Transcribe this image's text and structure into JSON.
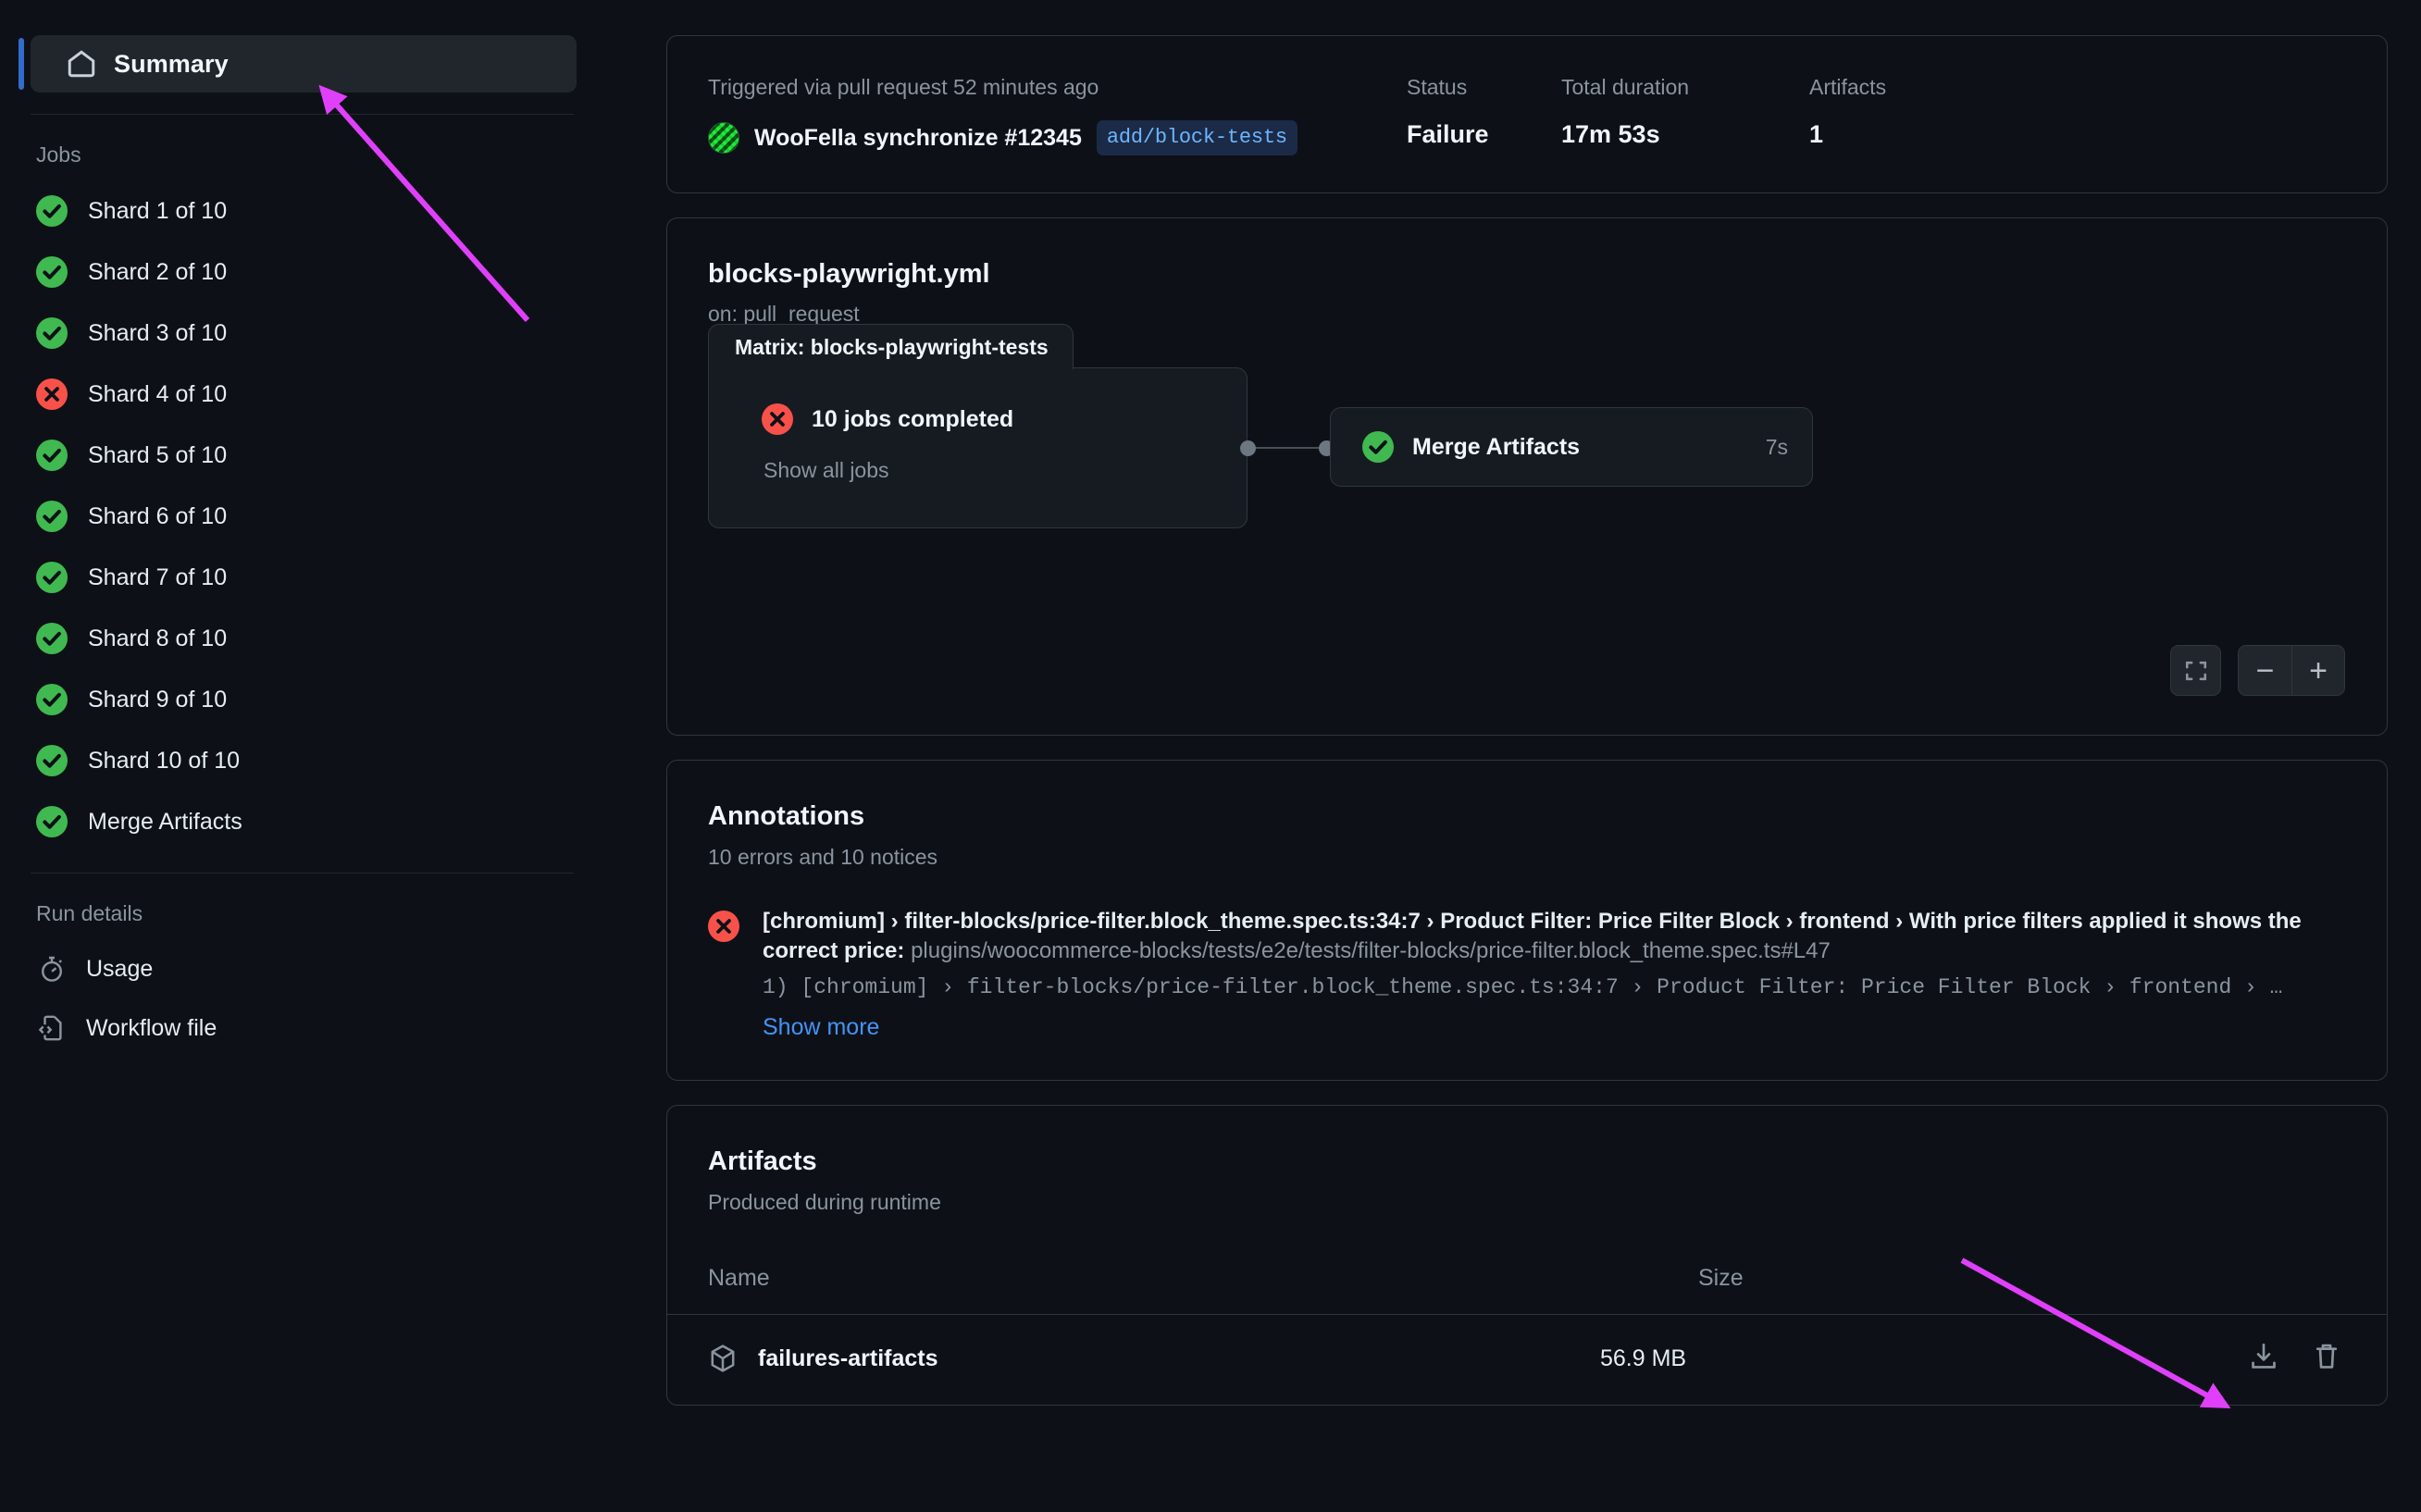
{
  "sidebar": {
    "summary": {
      "label": "Summary",
      "icon": "home-icon"
    },
    "jobs_title": "Jobs",
    "jobs": [
      {
        "label": "Shard 1 of 10",
        "status": "success"
      },
      {
        "label": "Shard 2 of 10",
        "status": "success"
      },
      {
        "label": "Shard 3 of 10",
        "status": "success"
      },
      {
        "label": "Shard 4 of 10",
        "status": "failure"
      },
      {
        "label": "Shard 5 of 10",
        "status": "success"
      },
      {
        "label": "Shard 6 of 10",
        "status": "success"
      },
      {
        "label": "Shard 7 of 10",
        "status": "success"
      },
      {
        "label": "Shard 8 of 10",
        "status": "success"
      },
      {
        "label": "Shard 9 of 10",
        "status": "success"
      },
      {
        "label": "Shard 10 of 10",
        "status": "success"
      },
      {
        "label": "Merge Artifacts",
        "status": "success"
      }
    ],
    "run_details_title": "Run details",
    "run_details": [
      {
        "label": "Usage",
        "icon": "stopwatch-icon"
      },
      {
        "label": "Workflow file",
        "icon": "code-file-icon"
      }
    ]
  },
  "header": {
    "trigger_text": "Triggered via pull request 52 minutes ago",
    "actor": "WooFella",
    "event": "synchronize",
    "pr_number": "#12345",
    "actor_line": "WooFella synchronize #12345",
    "branch": "add/block-tests",
    "status_label": "Status",
    "status_value": "Failure",
    "duration_label": "Total duration",
    "duration_value": "17m 53s",
    "artifacts_label": "Artifacts",
    "artifacts_value": "1"
  },
  "graph": {
    "workflow_file": "blocks-playwright.yml",
    "trigger": "on: pull_request",
    "matrix_title": "Matrix: blocks-playwright-tests",
    "matrix_jobs": "10 jobs completed",
    "matrix_status": "failure",
    "show_all_jobs": "Show all jobs",
    "merge_node": "Merge Artifacts",
    "merge_status": "success",
    "merge_time": "7s",
    "controls": {
      "fit": "fit-screen-icon",
      "zoom_out": "−",
      "zoom_in": "+"
    }
  },
  "annotations": {
    "title": "Annotations",
    "subtitle": "10 errors and 10 notices",
    "items": [
      {
        "status": "failure",
        "title": "[chromium] › filter-blocks/price-filter.block_theme.spec.ts:34:7 › Product Filter: Price Filter Block › frontend › With price filters applied it shows the correct price:",
        "path": "plugins/woocommerce-blocks/tests/e2e/tests/filter-blocks/price-filter.block_theme.spec.ts#L47",
        "detail": "1) [chromium] › filter-blocks/price-filter.block_theme.spec.ts:34:7 › Product Filter: Price Filter Block › frontend › …"
      }
    ],
    "show_more": "Show more"
  },
  "artifacts": {
    "title": "Artifacts",
    "subtitle": "Produced during runtime",
    "columns": {
      "name": "Name",
      "size": "Size"
    },
    "rows": [
      {
        "name": "failures-artifacts",
        "size": "56.9 MB",
        "icon": "package-icon",
        "download": "download-icon",
        "delete": "trash-icon"
      }
    ]
  },
  "colors": {
    "success": "#3fb950",
    "failure": "#f85149",
    "link": "#4493f8",
    "accent": "#316dca",
    "annotation_arrow": "#e040fb"
  }
}
